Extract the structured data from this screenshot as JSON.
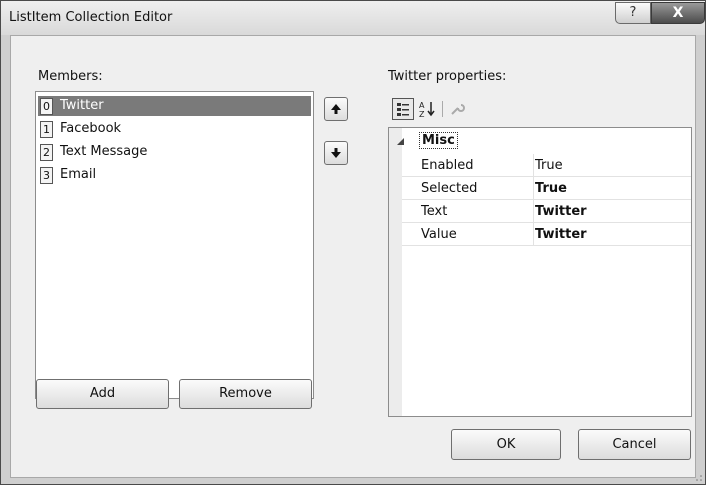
{
  "window": {
    "title": "ListItem Collection Editor",
    "help_label": "?",
    "close_label": "X"
  },
  "members": {
    "label": "Members:",
    "items": [
      {
        "index": "0",
        "label": "Twitter"
      },
      {
        "index": "1",
        "label": "Facebook"
      },
      {
        "index": "2",
        "label": "Text Message"
      },
      {
        "index": "3",
        "label": "Email"
      }
    ],
    "selected_index": 0,
    "add_label": "Add",
    "remove_label": "Remove"
  },
  "properties": {
    "label": "Twitter properties:",
    "category": "Misc",
    "rows": [
      {
        "name": "Enabled",
        "value": "True",
        "bold": false
      },
      {
        "name": "Selected",
        "value": "True",
        "bold": true
      },
      {
        "name": "Text",
        "value": "Twitter",
        "bold": true
      },
      {
        "name": "Value",
        "value": "Twitter",
        "bold": true
      }
    ]
  },
  "footer": {
    "ok_label": "OK",
    "cancel_label": "Cancel"
  }
}
